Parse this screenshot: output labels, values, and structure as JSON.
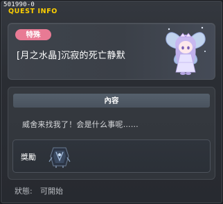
{
  "window": {
    "quest_id": "501990-0",
    "title": "QUEST INFO"
  },
  "header": {
    "badge": "特殊",
    "quest_title": "[月之水晶]沉寂的死亡静默",
    "npc_icon": "fairy-npc-portrait"
  },
  "content": {
    "section_title": "內容",
    "description": "威舍来找我了！会是什么事呢……",
    "reward_label": "獎勵",
    "reward_icon": "dark-armor-item"
  },
  "status": {
    "label": "狀態:",
    "value": "可開始"
  },
  "colors": {
    "badge": "#e87a94",
    "title_accent": "#ffd000",
    "background": "#2a2d33"
  }
}
